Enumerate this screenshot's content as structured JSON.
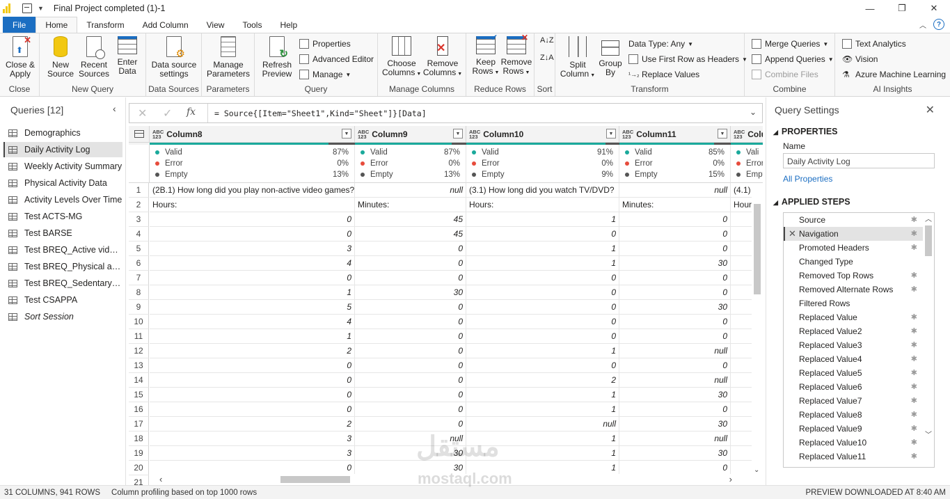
{
  "titlebar": {
    "title": "Final Project completed (1)-1"
  },
  "menu": {
    "tabs": [
      "File",
      "Home",
      "Transform",
      "Add Column",
      "View",
      "Tools",
      "Help"
    ]
  },
  "ribbon": {
    "groups": {
      "close": "Close",
      "new_query": "New Query",
      "data_sources": "Data Sources",
      "parameters": "Parameters",
      "query": "Query",
      "manage_columns": "Manage Columns",
      "reduce_rows": "Reduce Rows",
      "sort": "Sort",
      "transform": "Transform",
      "combine": "Combine",
      "ai_insights": "AI Insights"
    },
    "buttons": {
      "close_apply": [
        "Close &",
        "Apply"
      ],
      "new_source": [
        "New",
        "Source"
      ],
      "recent_sources": [
        "Recent",
        "Sources"
      ],
      "enter_data": [
        "Enter",
        "Data"
      ],
      "data_source_settings": [
        "Data source",
        "settings"
      ],
      "manage_parameters": [
        "Manage",
        "Parameters"
      ],
      "refresh_preview": [
        "Refresh",
        "Preview"
      ],
      "properties": "Properties",
      "advanced_editor": "Advanced Editor",
      "manage": "Manage",
      "choose_columns": [
        "Choose",
        "Columns"
      ],
      "remove_columns": [
        "Remove",
        "Columns"
      ],
      "keep_rows": [
        "Keep",
        "Rows"
      ],
      "remove_rows": [
        "Remove",
        "Rows"
      ],
      "split_column": [
        "Split",
        "Column"
      ],
      "group_by": [
        "Group",
        "By"
      ],
      "data_type": "Data Type: Any",
      "first_row_headers": "Use First Row as Headers",
      "replace_values": "Replace Values",
      "merge_queries": "Merge Queries",
      "append_queries": "Append Queries",
      "combine_files": "Combine Files",
      "text_analytics": "Text Analytics",
      "vision": "Vision",
      "azure_ml": "Azure Machine Learning"
    }
  },
  "queries": {
    "header": "Queries [12]",
    "items": [
      "Demographics",
      "Daily Activity Log",
      "Weekly Activity Summary",
      "Physical Activity Data",
      "Activity Levels Over Time",
      "Test ACTS-MG",
      "Test BARSE",
      "Test BREQ_Active video...",
      "Test BREQ_Physical activi...",
      "Test BREQ_Sedentary be...",
      "Test CSAPPA",
      "Sort Session"
    ]
  },
  "formula": {
    "text": "= Source{[Item=\"Sheet1\",Kind=\"Sheet\"]}[Data]"
  },
  "grid": {
    "columns": [
      {
        "type": "ABC\n123",
        "name": "Column8",
        "valid": "87%",
        "error": "0%",
        "empty": "13%"
      },
      {
        "type": "ABC\n123",
        "name": "Column9",
        "valid": "87%",
        "error": "0%",
        "empty": "13%"
      },
      {
        "type": "ABC\n123",
        "name": "Column10",
        "valid": "91%",
        "error": "0%",
        "empty": "9%"
      },
      {
        "type": "ABC\n123",
        "name": "Column11",
        "valid": "85%",
        "error": "0%",
        "empty": "15%"
      },
      {
        "type": "ABC\n123",
        "name": "Colu",
        "valid": "",
        "error": "",
        "empty": ""
      }
    ],
    "profile_labels": {
      "valid": "Valid",
      "error": "Error",
      "empty": "Empty",
      "valid_cut": "Vali",
      "error_cut": "Error",
      "empty_cut": "Empt"
    },
    "rows": [
      [
        "1",
        "(2B.1) How long did you play non-active video games?",
        "null",
        "(3.1)  How long did you watch TV/DVD?",
        "null",
        "(4.1)"
      ],
      [
        "2",
        "Hours:",
        "Minutes:",
        "Hours:",
        "Minutes:",
        "Hours:"
      ],
      [
        "3",
        "0",
        "45",
        "1",
        "0",
        ""
      ],
      [
        "4",
        "0",
        "45",
        "0",
        "0",
        ""
      ],
      [
        "5",
        "3",
        "0",
        "1",
        "0",
        ""
      ],
      [
        "6",
        "4",
        "0",
        "1",
        "30",
        ""
      ],
      [
        "7",
        "0",
        "0",
        "0",
        "0",
        ""
      ],
      [
        "8",
        "1",
        "30",
        "0",
        "0",
        ""
      ],
      [
        "9",
        "5",
        "0",
        "0",
        "30",
        ""
      ],
      [
        "10",
        "4",
        "0",
        "0",
        "0",
        ""
      ],
      [
        "11",
        "1",
        "0",
        "0",
        "0",
        ""
      ],
      [
        "12",
        "2",
        "0",
        "1",
        "null",
        ""
      ],
      [
        "13",
        "0",
        "0",
        "0",
        "0",
        ""
      ],
      [
        "14",
        "0",
        "0",
        "2",
        "null",
        ""
      ],
      [
        "15",
        "0",
        "0",
        "1",
        "30",
        ""
      ],
      [
        "16",
        "0",
        "0",
        "1",
        "0",
        ""
      ],
      [
        "17",
        "2",
        "0",
        "null",
        "30",
        ""
      ],
      [
        "18",
        "3",
        "null",
        "1",
        "null",
        ""
      ],
      [
        "19",
        "3",
        "30",
        "1",
        "30",
        ""
      ],
      [
        "20",
        "0",
        "30",
        "1",
        "0",
        ""
      ],
      [
        "21",
        "",
        "",
        "",
        "",
        ""
      ]
    ]
  },
  "settings": {
    "title": "Query Settings",
    "properties": "PROPERTIES",
    "name_label": "Name",
    "name_value": "Daily Activity Log",
    "all_properties": "All Properties",
    "applied_steps": "APPLIED STEPS",
    "steps": [
      "Source",
      "Navigation",
      "Promoted Headers",
      "Changed Type",
      "Removed Top Rows",
      "Removed Alternate Rows",
      "Filtered Rows",
      "Replaced Value",
      "Replaced Value2",
      "Replaced Value3",
      "Replaced Value4",
      "Replaced Value5",
      "Replaced Value6",
      "Replaced Value7",
      "Replaced Value8",
      "Replaced Value9",
      "Replaced Value10",
      "Replaced Value11"
    ]
  },
  "status": {
    "left": "31 COLUMNS, 941 ROWS",
    "profiling": "Column profiling based on top 1000 rows",
    "right": "PREVIEW DOWNLOADED AT 8:40 AM"
  },
  "watermark": {
    "arabic": "مستقل",
    "latin": "mostaql.com"
  },
  "colors": {
    "accent": "#1b6ec2",
    "valid": "#1aa99b",
    "error": "#e74c3c",
    "empty": "#555555"
  }
}
